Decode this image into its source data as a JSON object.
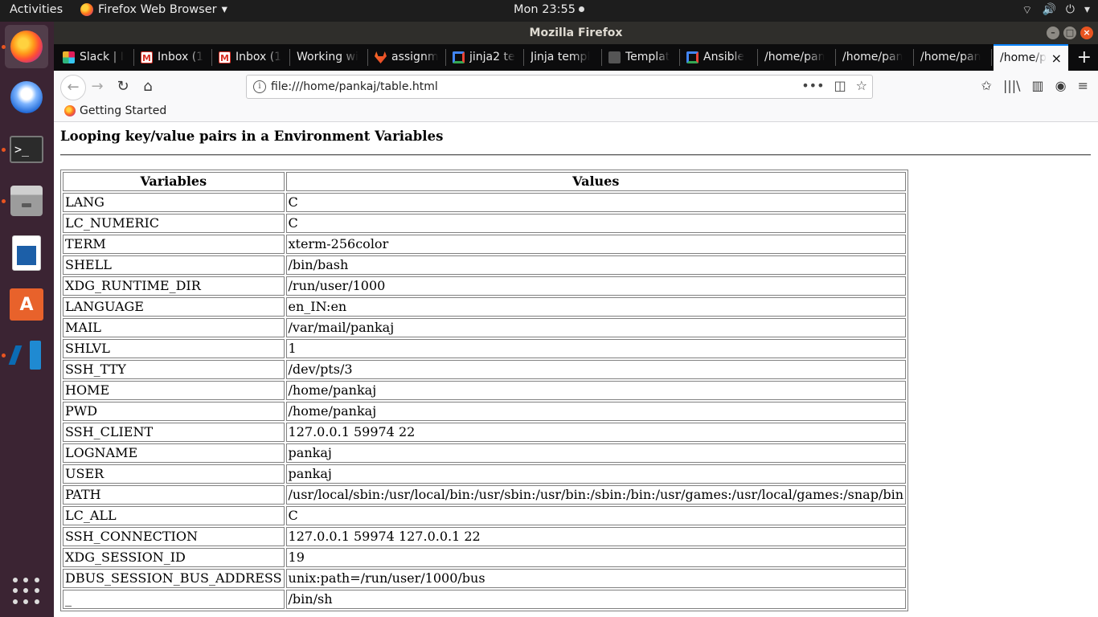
{
  "topbar": {
    "activities": "Activities",
    "app_name": "Firefox Web Browser",
    "app_menu_arrow": "▾",
    "clock": "Mon 23:55",
    "tray": {
      "network": "⌔",
      "volume": "🔊",
      "power": "⏻",
      "arrow": "▾"
    }
  },
  "window": {
    "title": "Mozilla Firefox",
    "minimize": "–",
    "maximize": "□",
    "close": "×"
  },
  "tabs": [
    {
      "label": "Slack | I",
      "icon": "slack-icon"
    },
    {
      "label": "Inbox (1",
      "icon": "gmail-icon"
    },
    {
      "label": "Inbox (1",
      "icon": "gmail-icon"
    },
    {
      "label": "Working wi",
      "icon": ""
    },
    {
      "label": "assignm",
      "icon": "gitlab-icon"
    },
    {
      "label": "jinja2 te",
      "icon": "google-icon"
    },
    {
      "label": "Jinja templ",
      "icon": ""
    },
    {
      "label": "Templat",
      "icon": "template-icon"
    },
    {
      "label": "Ansible",
      "icon": "google-icon"
    },
    {
      "label": "/home/pan",
      "icon": ""
    },
    {
      "label": "/home/pan",
      "icon": ""
    },
    {
      "label": "/home/pan",
      "icon": ""
    },
    {
      "label": "/home/p",
      "icon": "",
      "active": true
    }
  ],
  "tab_close": "×",
  "new_tab": "+",
  "nav": {
    "back": "←",
    "forward": "→",
    "reload": "↻",
    "home": "⌂",
    "url": "file:///home/pankaj/table.html",
    "url_info": "i",
    "page_actions": "•••",
    "pocket": "◫",
    "bookmark_star": "☆",
    "reading_list": "✩",
    "library": "|||\\",
    "sidebar": "▥",
    "account": "◉",
    "menu": "≡"
  },
  "bookmarks": [
    {
      "label": "Getting Started"
    }
  ],
  "page": {
    "heading": "Looping key/value pairs in a Environment Variables",
    "table": {
      "headers": [
        "Variables",
        "Values"
      ],
      "rows": [
        [
          "LANG",
          "C"
        ],
        [
          "LC_NUMERIC",
          "C"
        ],
        [
          "TERM",
          "xterm-256color"
        ],
        [
          "SHELL",
          "/bin/bash"
        ],
        [
          "XDG_RUNTIME_DIR",
          "/run/user/1000"
        ],
        [
          "LANGUAGE",
          "en_IN:en"
        ],
        [
          "MAIL",
          "/var/mail/pankaj"
        ],
        [
          "SHLVL",
          "1"
        ],
        [
          "SSH_TTY",
          "/dev/pts/3"
        ],
        [
          "HOME",
          "/home/pankaj"
        ],
        [
          "PWD",
          "/home/pankaj"
        ],
        [
          "SSH_CLIENT",
          "127.0.0.1 59974 22"
        ],
        [
          "LOGNAME",
          "pankaj"
        ],
        [
          "USER",
          "pankaj"
        ],
        [
          "PATH",
          "/usr/local/sbin:/usr/local/bin:/usr/sbin:/usr/bin:/sbin:/bin:/usr/games:/usr/local/games:/snap/bin"
        ],
        [
          "LC_ALL",
          "C"
        ],
        [
          "SSH_CONNECTION",
          "127.0.0.1 59974 127.0.0.1 22"
        ],
        [
          "XDG_SESSION_ID",
          "19"
        ],
        [
          "DBUS_SESSION_BUS_ADDRESS",
          "unix:path=/run/user/1000/bus"
        ],
        [
          "_",
          "/bin/sh"
        ]
      ]
    }
  },
  "dock": [
    {
      "name": "firefox-icon",
      "running": true,
      "active": true
    },
    {
      "name": "thunderbird-icon",
      "running": false
    },
    {
      "name": "terminal-icon",
      "running": true,
      "glyph": ">_"
    },
    {
      "name": "files-icon",
      "running": true
    },
    {
      "name": "writer-icon",
      "running": false
    },
    {
      "name": "software-store-icon",
      "running": false,
      "glyph": "A"
    },
    {
      "name": "vscode-icon",
      "running": true
    }
  ],
  "colors": {
    "accent": "#e95420",
    "tab_active_line": "#0a84ff",
    "dock_bg": "#3b2433"
  }
}
